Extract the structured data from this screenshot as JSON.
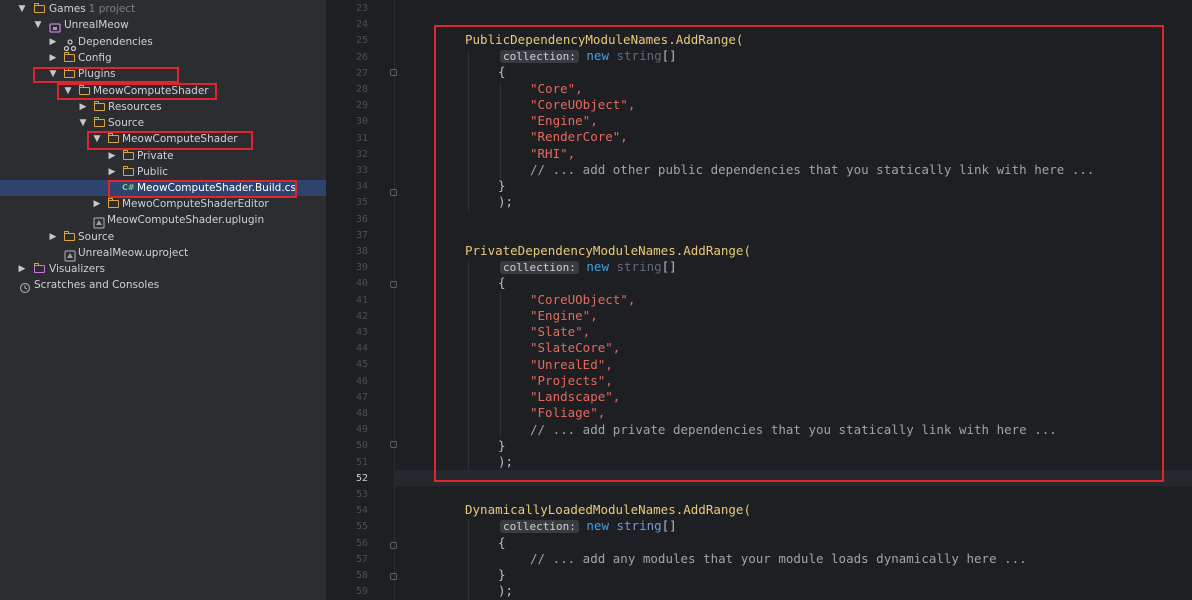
{
  "sidebar": {
    "root": {
      "label": "Games",
      "suffix": " · 1 project"
    },
    "project": {
      "label": "UnrealMeow"
    },
    "dependencies": {
      "label": "Dependencies"
    },
    "config": {
      "label": "Config"
    },
    "plugins": {
      "label": "Plugins"
    },
    "plugin": {
      "label": "MeowComputeShader"
    },
    "resources": {
      "label": "Resources"
    },
    "plugin_source": {
      "label": "Source"
    },
    "module": {
      "label": "MeowComputeShader"
    },
    "private": {
      "label": "Private"
    },
    "public": {
      "label": "Public"
    },
    "build_file": {
      "label": "MeowComputeShader.Build.cs",
      "icon": "C#"
    },
    "editor_module": {
      "label": "MewoComputeShaderEditor"
    },
    "uplugin": {
      "label": "MeowComputeShader.uplugin"
    },
    "project_source": {
      "label": "Source"
    },
    "uproject": {
      "label": "UnrealMeow.uproject"
    },
    "visualizers": {
      "label": "Visualizers"
    },
    "scratches": {
      "label": "Scratches and Consoles"
    }
  },
  "editor": {
    "line_numbers": [
      "23",
      "24",
      "25",
      "26",
      "27",
      "28",
      "29",
      "30",
      "31",
      "32",
      "33",
      "34",
      "35",
      "36",
      "37",
      "38",
      "39",
      "40",
      "41",
      "42",
      "43",
      "44",
      "45",
      "46",
      "47",
      "48",
      "49",
      "50",
      "51",
      "52",
      "53",
      "54",
      "55",
      "56",
      "57",
      "58",
      "59"
    ],
    "current_line": "52",
    "code": {
      "public_call": "PublicDependencyModuleNames",
      "public_method": ".AddRange(",
      "hint_label": "collection:",
      "kw_new": "new",
      "type_string": "string",
      "brackets": "[]",
      "open_brace": "{",
      "close_brace": "}",
      "close_paren": ");",
      "pub_deps": [
        "\"Core\",",
        "\"CoreUObject\",",
        "\"Engine\",",
        "\"RenderCore\",",
        "\"RHI\","
      ],
      "pub_comment": "// ... add other public dependencies that you statically link with here ...",
      "private_call": "PrivateDependencyModuleNames",
      "private_method": ".AddRange(",
      "priv_deps": [
        "\"CoreUObject\",",
        "\"Engine\",",
        "\"Slate\",",
        "\"SlateCore\",",
        "\"UnrealEd\",",
        "\"Projects\",",
        "\"Landscape\",",
        "\"Foliage\","
      ],
      "priv_comment": "// ... add private dependencies that you statically link with here ...",
      "dynamic_call": "DynamicallyLoadedModuleNames",
      "dynamic_method": ".AddRange(",
      "dyn_comment": "// ... add any modules that your module loads dynamically here ..."
    }
  },
  "colors": {
    "highlight_box": "#e0252c",
    "selection": "#2e436e",
    "folder": "#d9a441",
    "string": "#e36a5f",
    "keyword": "#3f9fe7",
    "method": "#e8c97a"
  }
}
